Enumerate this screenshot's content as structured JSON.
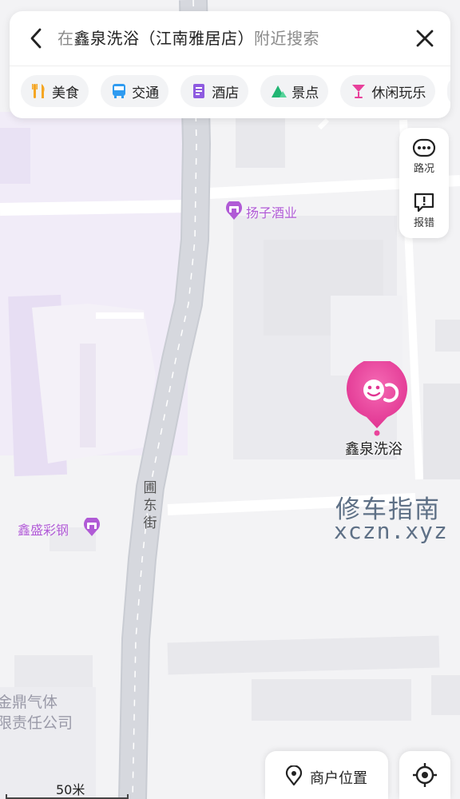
{
  "search": {
    "prefix": "在",
    "query": "鑫泉洗浴（江南雅居店）",
    "suffix": "附近搜索"
  },
  "categories": [
    {
      "label": "美食",
      "icon": "food-icon",
      "color": "#f5a623"
    },
    {
      "label": "交通",
      "icon": "bus-icon",
      "color": "#2f9bf0"
    },
    {
      "label": "酒店",
      "icon": "hotel-icon",
      "color": "#8e5be0"
    },
    {
      "label": "景点",
      "icon": "scenic-icon",
      "color": "#21b573"
    },
    {
      "label": "休闲玩乐",
      "icon": "cocktail-icon",
      "color": "#e8409b"
    }
  ],
  "side_buttons": {
    "traffic": "路况",
    "report": "报错"
  },
  "map": {
    "selected_place": "鑫泉洗浴",
    "pois": [
      {
        "name": "扬子酒业",
        "icon": "shop-icon"
      },
      {
        "name": "鑫盛彩钢",
        "icon": "shop-icon"
      }
    ],
    "street": "圃东街",
    "partial_label": [
      "金鼎气体",
      "限责任公司"
    ],
    "accent": "#e9449b",
    "poi_color": "#b05ad6"
  },
  "watermark": {
    "line1": "修车指南",
    "line2": "xczn.xyz"
  },
  "bottom": {
    "business_location": "商户位置",
    "scale": "50米"
  }
}
